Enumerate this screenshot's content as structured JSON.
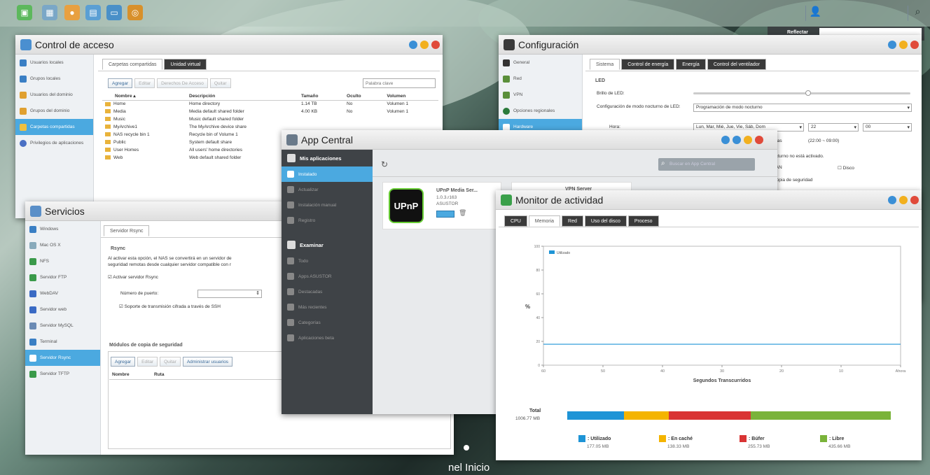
{
  "taskbar": {
    "icons": [
      "desktop-icon",
      "apps-icon",
      "user-icon",
      "monitor-icon",
      "window-icon",
      "settings-icon"
    ],
    "user_icon": "user-icon",
    "search_icon": "search-icon"
  },
  "reflector": {
    "label": "Reflectar"
  },
  "desktop": {
    "label": "nel Inicio"
  },
  "acceso": {
    "title": "Control de acceso",
    "sidebar": [
      "Usuarios locales",
      "Grupos locales",
      "Usuarios del dominio",
      "Grupos del dominio",
      "Carpetas compartidas",
      "Privilegios de aplicaciones"
    ],
    "tabs": [
      "Carpetas compartidas",
      "Unidad virtual"
    ],
    "buttons": [
      "Agregar",
      "Editar",
      "Derechos De Acceso",
      "Quitar"
    ],
    "search_placeholder": "Palabra clave",
    "columns": [
      "Nombre",
      "Descripción",
      "Tamaño",
      "Oculto",
      "Volumen"
    ],
    "rows": [
      [
        "Home",
        "Home directory",
        "1.14 TB",
        "No",
        "Volumen 1"
      ],
      [
        "Media",
        "Media default shared folder",
        "4.00 KB",
        "No",
        "Volumen 1"
      ],
      [
        "Music",
        "Music default shared folder",
        "",
        "",
        ""
      ],
      [
        "MyArchive1",
        "The MyArchive device share",
        "",
        "",
        ""
      ],
      [
        "NAS recycle bin 1",
        "Recycle bin of Volume 1",
        "",
        "",
        ""
      ],
      [
        "Public",
        "System default share",
        "",
        "",
        ""
      ],
      [
        "User Homes",
        "All users' home directories",
        "",
        "",
        ""
      ],
      [
        "Web",
        "Web default shared folder",
        "",
        "",
        ""
      ]
    ]
  },
  "config": {
    "title": "Configuración",
    "sidebar": [
      "General",
      "Red",
      "VPN",
      "Opciones regionales",
      "Hardware"
    ],
    "tabs": [
      "Sistema",
      "Control de energía",
      "Energía",
      "Control del ventilador"
    ],
    "section": "LED",
    "brillo_label": "Brillo de LED:",
    "night_label": "Configuración de modo nocturno de LED:",
    "night_value": "Programación de modo nocturno",
    "hora_label": "Hora:",
    "days_value": "Lun, Mar, Mié, Jue, Vie, Sáb, Dom",
    "hour_value": "22",
    "minute_value": "00",
    "horas_label": "oras",
    "range_text": "(22:00 ~ 09:00)",
    "nocturno_text": "octurno no está activado.",
    "lan_label": "LAN",
    "disco_label": "Disco",
    "copia_label": "Copia de seguridad"
  },
  "servicios": {
    "title": "Servicios",
    "sidebar": [
      "Windows",
      "Mac OS X",
      "NFS",
      "Servidor FTP",
      "WebDAV",
      "Servidor web",
      "Servidor MySQL",
      "Terminal",
      "Servidor Rsync",
      "Servidor TFTP"
    ],
    "tab": "Servidor Rsync",
    "section": "Rsync",
    "desc1": "Al activar esta opción, el NAS se convertirá en un servidor de",
    "desc2": "seguridad remotas desde cualquier servidor compatible con r",
    "enable_label": "Activar servidor Rsync",
    "port_label": "Número de puerto:",
    "ssh_label": "Soporte de transmisión cifrada a través de SSH",
    "modules_section": "Módulos de copia de seguridad",
    "buttons": [
      "Agregar",
      "Editar",
      "Quitar",
      "Administrar usuarios"
    ],
    "columns": [
      "Nombre",
      "Ruta"
    ]
  },
  "appcentral": {
    "title": "App Central",
    "sidebar_head1": "Mis aplicaciones",
    "sidebar1": [
      "Instalado",
      "Actualizar",
      "Instalación manual",
      "Registro"
    ],
    "sidebar_head2": "Examinar",
    "sidebar2": [
      "Todo",
      "Apps ASUSTOR",
      "Destacadas",
      "Más recientes",
      "Categorías",
      "Aplicaciones beta"
    ],
    "search_placeholder": "Buscar en App Central",
    "app_name": "UPnP Media Ser...",
    "app_version": "1.0.3.r163",
    "app_vendor": "ASUSTOR",
    "app_logo": "UPnP",
    "app2_name": "VPN Server"
  },
  "monitor": {
    "title": "Monitor de actividad",
    "tabs": [
      "CPU",
      "Memoria",
      "Red",
      "Uso del disco",
      "Proceso"
    ],
    "ylabel": "%",
    "xlabel": "Segundos Transcurridos",
    "legend": "Utilizado",
    "total_label": "Total",
    "total_value": "1006.77 MB",
    "legend_items": [
      {
        "label": ": Utilizado",
        "value": "177.05 MB",
        "color": "#1e94d6"
      },
      {
        "label": ": En caché",
        "value": "138.33 MB",
        "color": "#f4b400"
      },
      {
        "label": ": Búfer",
        "value": "255.73 MB",
        "color": "#d93434"
      },
      {
        "label": ": Libre",
        "value": "435.66 MB",
        "color": "#7ab33a"
      }
    ]
  },
  "chart_data": {
    "type": "line",
    "xlabel": "Segundos Transcurridos",
    "ylabel": "%",
    "x_ticks": [
      "60",
      "50",
      "40",
      "30",
      "20",
      "10",
      "Ahora"
    ],
    "y_ticks": [
      "100",
      "80",
      "60",
      "40",
      "20",
      "0"
    ],
    "ylim": [
      0,
      100
    ],
    "series": [
      {
        "name": "Utilizado",
        "x": [
          60,
          0
        ],
        "y": [
          17.6,
          17.6
        ],
        "color": "#1e94d6"
      }
    ],
    "bar": {
      "total_mb": 1006.77,
      "segments_mb": [
        177.05,
        138.33,
        255.73,
        435.66
      ]
    }
  }
}
